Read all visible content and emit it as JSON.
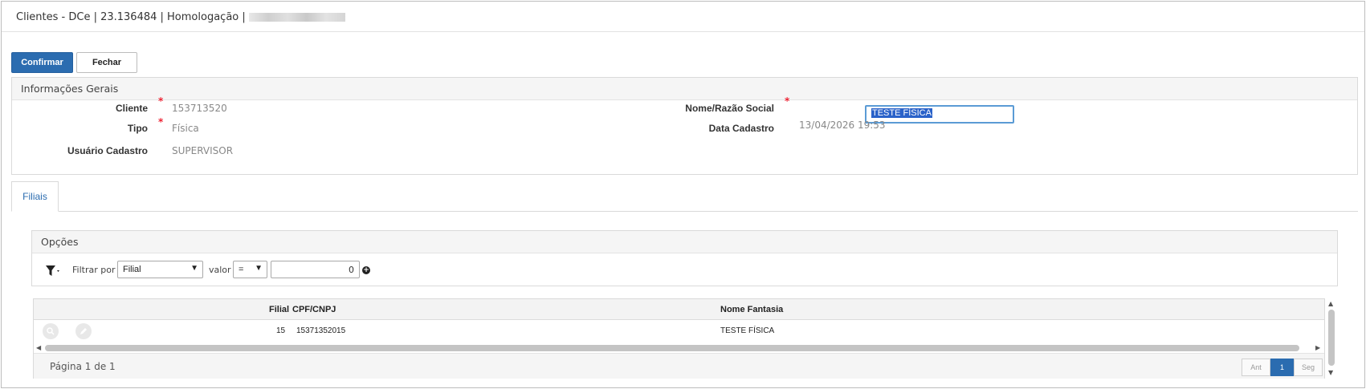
{
  "window": {
    "title": "Clientes - DCe | 23.136484 | Homologação |"
  },
  "toolbar": {
    "confirm_label": "Confirmar",
    "close_label": "Fechar"
  },
  "general_panel": {
    "title": "Informações Gerais",
    "cliente_label": "Cliente",
    "cliente_value": "153713520",
    "tipo_label": "Tipo",
    "tipo_value": "Física",
    "usuario_label": "Usuário Cadastro",
    "usuario_value": "SUPERVISOR",
    "nome_label": "Nome/Razão Social",
    "nome_value": "TESTE FÍSICA",
    "data_label": "Data Cadastro",
    "data_value": "13/04/2026 19:53",
    "required_mark": "*"
  },
  "tabs": [
    {
      "label": "Filiais",
      "active": true
    }
  ],
  "options_panel": {
    "title": "Opções",
    "filter_label": "Filtrar por",
    "filter_field_selected": "Filial",
    "value_label": "valor",
    "operator_selected": "=",
    "filter_value": "0"
  },
  "grid": {
    "columns": [
      "Filial",
      "CPF/CNPJ",
      "Nome Fantasia"
    ],
    "rows": [
      {
        "filial": "15",
        "cpf_cnpj": "15371352015",
        "nome_fantasia": "TESTE FÍSICA"
      }
    ],
    "page_info": "Página 1 de 1",
    "pager_prev": "Ant",
    "pager_current": "1",
    "pager_next": "Seg"
  },
  "icons": {
    "filter": "filter-icon",
    "add": "plus-circle-icon",
    "view": "search-icon",
    "edit": "pencil-icon"
  },
  "colors": {
    "primary": "#2b6cb0",
    "required": "#ee2233"
  }
}
